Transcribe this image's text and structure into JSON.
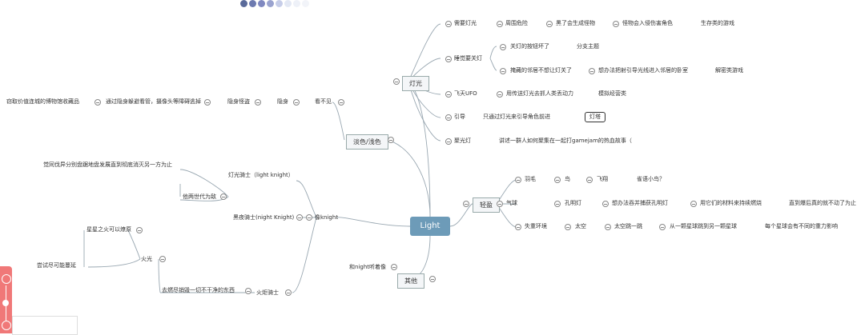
{
  "toolbar": {
    "dot_colors": [
      "#5a6a9a",
      "#6d7ab0",
      "#7f88c0",
      "#9aa3cf",
      "#c6cde8",
      "#e3e8f4",
      "#eef1f8",
      "#f2f4f9"
    ]
  },
  "center": {
    "label": "Light"
  },
  "branches": {
    "light": {
      "label": "灯光"
    },
    "dim": {
      "label": "淡色/浅色"
    },
    "knight": {
      "label": "像knight"
    },
    "light_weight": {
      "label": "轻盈"
    },
    "other": {
      "label": "其他"
    }
  },
  "nodes": {
    "need_light": "需要灯光",
    "surrounding_danger": "周围危险",
    "dark_spawn_monsters": "黑了会生成怪物",
    "monster_hurt_role": "怪物会入侵伤害角色",
    "survival_game": "生存类的游戏",
    "sleep_light_off": "睡觉要关灯",
    "switch_broken": "关灯的按钮坏了",
    "branch_theme": "分支主题",
    "dad_no_light": "掩藏的邻居不想让灯关了",
    "find_way_guide": "想办法把射引导光线进入邻居的卧室",
    "puzzle_game": "解密类游戏",
    "ufo": "飞天UFO",
    "catch_people": "用传送灯光去抓人类丢动力",
    "sim_business": "模拟经营类",
    "guide": "引导",
    "only_light_guide": "只通过灯光来引导角色前进",
    "lighthouse": "灯塔",
    "spotlight": "聚光灯",
    "gamejam_story": "讲述一群人如何聚集在一起打gamejam的热血故事（",
    "invisible": "看不见",
    "stealth": "隐身",
    "stealth_thief": "隐身怪盗",
    "avoid_camera": "通过隐身躲避看管，摄像头等障碍逃掉",
    "steal_treasure": "窃取价值连城的博物馆收藏品",
    "feather": "羽毛",
    "bird": "鸟",
    "fly": "飞翔",
    "bird_q": "雀语小鸟？",
    "balloon": "气球",
    "kongming": "孔明灯",
    "find_rise": "想办法吞并捕获孔明灯",
    "use_material": "用它们的材料来持续燃烧",
    "until_explode": "直到爆后真的就不动了为止",
    "weightless": "失重环境",
    "space": "太空",
    "space_jump": "太空跳一跳",
    "planet_jump": "从一颗星球跳到另一颗星球",
    "gravity_diff": "每个星球会有不同的重力影响",
    "light_knight": "灯光骑士（light knight）",
    "night_knight": "黑夜骑士(night Knight)",
    "generations": "他两世代为敌",
    "fight_story": "觉同伐异分别盘踞地盘发展直到彻底消灭另一方为止",
    "fire": "火光",
    "spark": "星星之火可以燎原",
    "try_spread": "尝试尽可能蔓延",
    "torch_knight": "火炬骑士",
    "burn_unclean": "去燃尽销毁一切不干净的东西",
    "night_sounds": "和night听着像"
  }
}
